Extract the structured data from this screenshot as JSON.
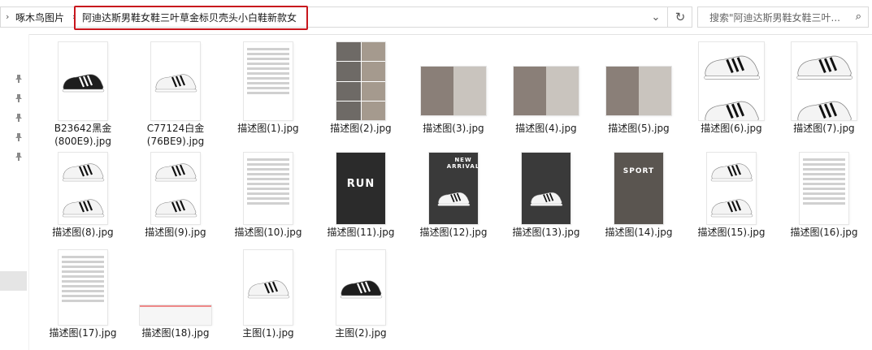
{
  "address": {
    "breadcrumb_root": "啄木鸟图片",
    "breadcrumb_current": "阿迪达斯男鞋女鞋三叶草金标贝壳头小白鞋新款女",
    "search_placeholder": "搜索\"阿迪达斯男鞋女鞋三叶...",
    "dropdown_icon": "chevron-down-icon",
    "refresh_icon": "refresh-icon",
    "search_icon": "search-icon"
  },
  "files": [
    {
      "line1": "B23642黑金",
      "line2": "(800E9).jpg",
      "kind": "black-shoe"
    },
    {
      "line1": "C77124白金",
      "line2": "(76BE9).jpg",
      "kind": "white-shoe"
    },
    {
      "line1": "描述图(1).jpg",
      "line2": "",
      "kind": "doc"
    },
    {
      "line1": "描述图(2).jpg",
      "line2": "",
      "kind": "collage"
    },
    {
      "line1": "描述图(3).jpg",
      "line2": "",
      "kind": "photo"
    },
    {
      "line1": "描述图(4).jpg",
      "line2": "",
      "kind": "photo"
    },
    {
      "line1": "描述图(5).jpg",
      "line2": "",
      "kind": "photo"
    },
    {
      "line1": "描述图(6).jpg",
      "line2": "",
      "kind": "white-pair"
    },
    {
      "line1": "描述图(7).jpg",
      "line2": "",
      "kind": "white-pair"
    },
    {
      "line1": "描述图(8).jpg",
      "line2": "",
      "kind": "white-pair"
    },
    {
      "line1": "描述图(9).jpg",
      "line2": "",
      "kind": "white-pair"
    },
    {
      "line1": "描述图(10).jpg",
      "line2": "",
      "kind": "doc"
    },
    {
      "line1": "描述图(11).jpg",
      "line2": "",
      "kind": "run"
    },
    {
      "line1": "描述图(12).jpg",
      "line2": "",
      "kind": "dark"
    },
    {
      "line1": "描述图(13).jpg",
      "line2": "",
      "kind": "dark"
    },
    {
      "line1": "描述图(14).jpg",
      "line2": "",
      "kind": "sport"
    },
    {
      "line1": "描述图(15).jpg",
      "line2": "",
      "kind": "white-pair"
    },
    {
      "line1": "描述图(16).jpg",
      "line2": "",
      "kind": "doc"
    },
    {
      "line1": "描述图(17).jpg",
      "line2": "",
      "kind": "doc"
    },
    {
      "line1": "描述图(18).jpg",
      "line2": "",
      "kind": "strip"
    },
    {
      "line1": "主图(1).jpg",
      "line2": "",
      "kind": "white-shoe"
    },
    {
      "line1": "主图(2).jpg",
      "line2": "",
      "kind": "black-shoe"
    }
  ],
  "thumb_overlays": {
    "run": "RUN",
    "sport": "SPORT",
    "new_arrival": "NEW ARRIVAL"
  },
  "colors": {
    "highlight_border": "#c8161d",
    "nav_selected": "#e5e5e5"
  }
}
